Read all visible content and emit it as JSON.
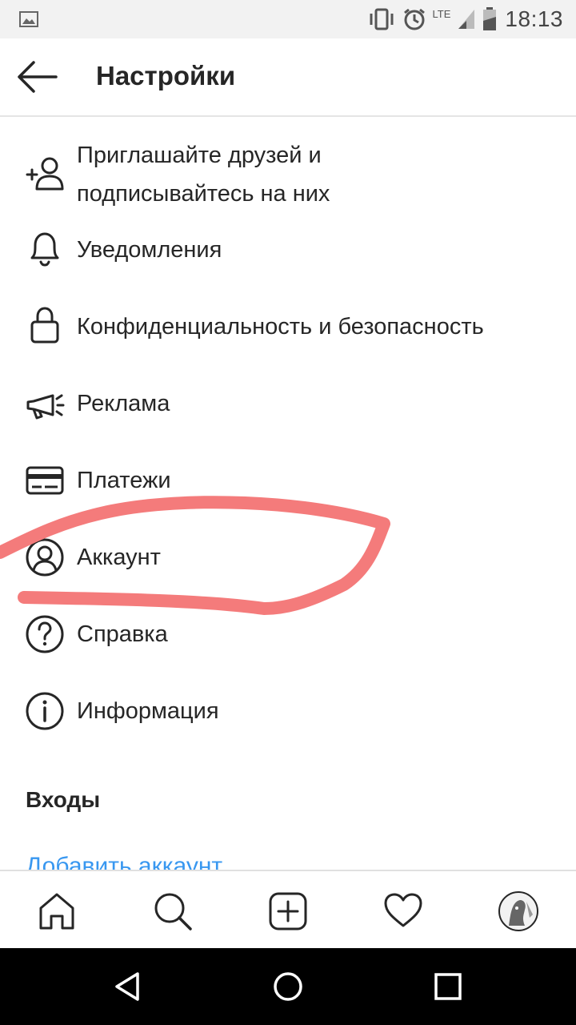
{
  "status_bar": {
    "network": "LTE",
    "time": "18:13"
  },
  "header": {
    "title": "Настройки",
    "back_icon": "arrow-left-icon"
  },
  "menu": {
    "items": [
      {
        "label_line1": "Приглашайте друзей и",
        "label_line2": "подписывайтесь на них",
        "icon": "add-person-icon"
      },
      {
        "label": "Уведомления",
        "icon": "bell-icon"
      },
      {
        "label": "Конфиденциальность и безопасность",
        "icon": "lock-icon"
      },
      {
        "label": "Реклама",
        "icon": "megaphone-icon"
      },
      {
        "label": "Платежи",
        "icon": "credit-card-icon"
      },
      {
        "label": "Аккаунт",
        "icon": "account-circle-icon"
      },
      {
        "label": "Справка",
        "icon": "help-circle-icon"
      },
      {
        "label": "Информация",
        "icon": "info-circle-icon"
      }
    ]
  },
  "logins": {
    "section_title": "Входы",
    "add_account": "Добавить аккаунт"
  },
  "tab_bar": {
    "tabs": [
      "home-icon",
      "search-icon",
      "add-post-icon",
      "heart-icon",
      "profile-avatar"
    ]
  },
  "nav_bar": {
    "buttons": [
      "back-triangle-icon",
      "home-circle-icon",
      "recents-square-icon"
    ]
  },
  "colors": {
    "link": "#3897f0",
    "annotation": "#f47b7b",
    "text": "#262626"
  }
}
